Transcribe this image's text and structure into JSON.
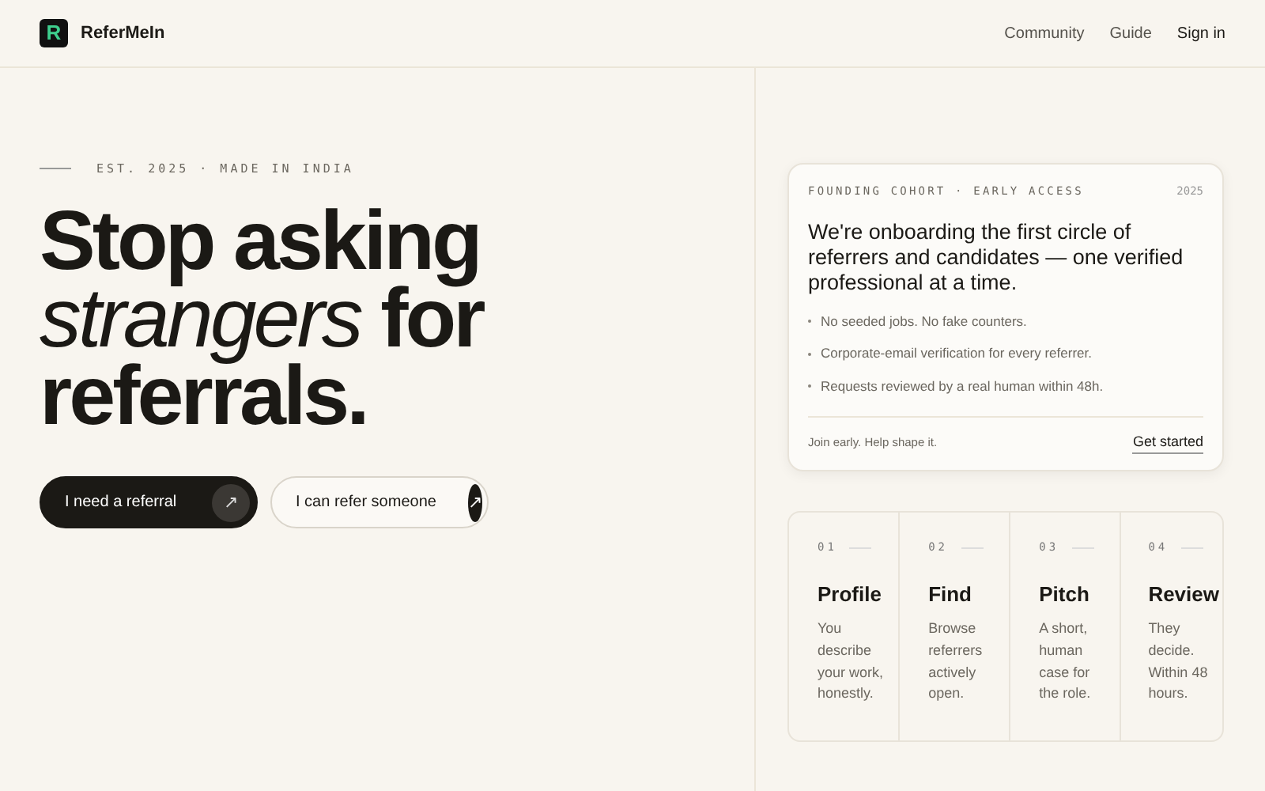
{
  "brand": {
    "logo_letter": "R",
    "name": "ReferMeIn"
  },
  "nav": [
    {
      "label": "Community",
      "kind": "link"
    },
    {
      "label": "Guide",
      "kind": "link"
    },
    {
      "label": "Sign in",
      "kind": "strong"
    }
  ],
  "eyebrow": "EST. 2025 · MADE IN INDIA",
  "headline": "Stop asking *strangers* for referrals.",
  "buttons": [
    {
      "label": "I need a referral",
      "kind": "primary",
      "icon": "↗"
    },
    {
      "label": "I can refer someone",
      "kind": "outline",
      "icon": "↗"
    }
  ],
  "cohort_card": {
    "eyebrow": "FOUNDING COHORT · EARLY ACCESS",
    "year": "2025",
    "title": "We're onboarding the first circle of referrers and candidates — one verified professional at a time.",
    "points": [
      "No seeded jobs. No fake counters.",
      "Corporate-email verification for every referrer.",
      "Requests reviewed by a real human within 48h."
    ],
    "footer_note": "Join early. Help shape it.",
    "cta": "Get started"
  },
  "steps": [
    {
      "number": "01",
      "title": "Profile",
      "text": "You describe your work, honestly."
    },
    {
      "number": "02",
      "title": "Find",
      "text": "Browse referrers actively open."
    },
    {
      "number": "03",
      "title": "Pitch",
      "text": "A short, human case for the role."
    },
    {
      "number": "04",
      "title": "Review",
      "text": "They decide. Within 48 hours."
    }
  ]
}
